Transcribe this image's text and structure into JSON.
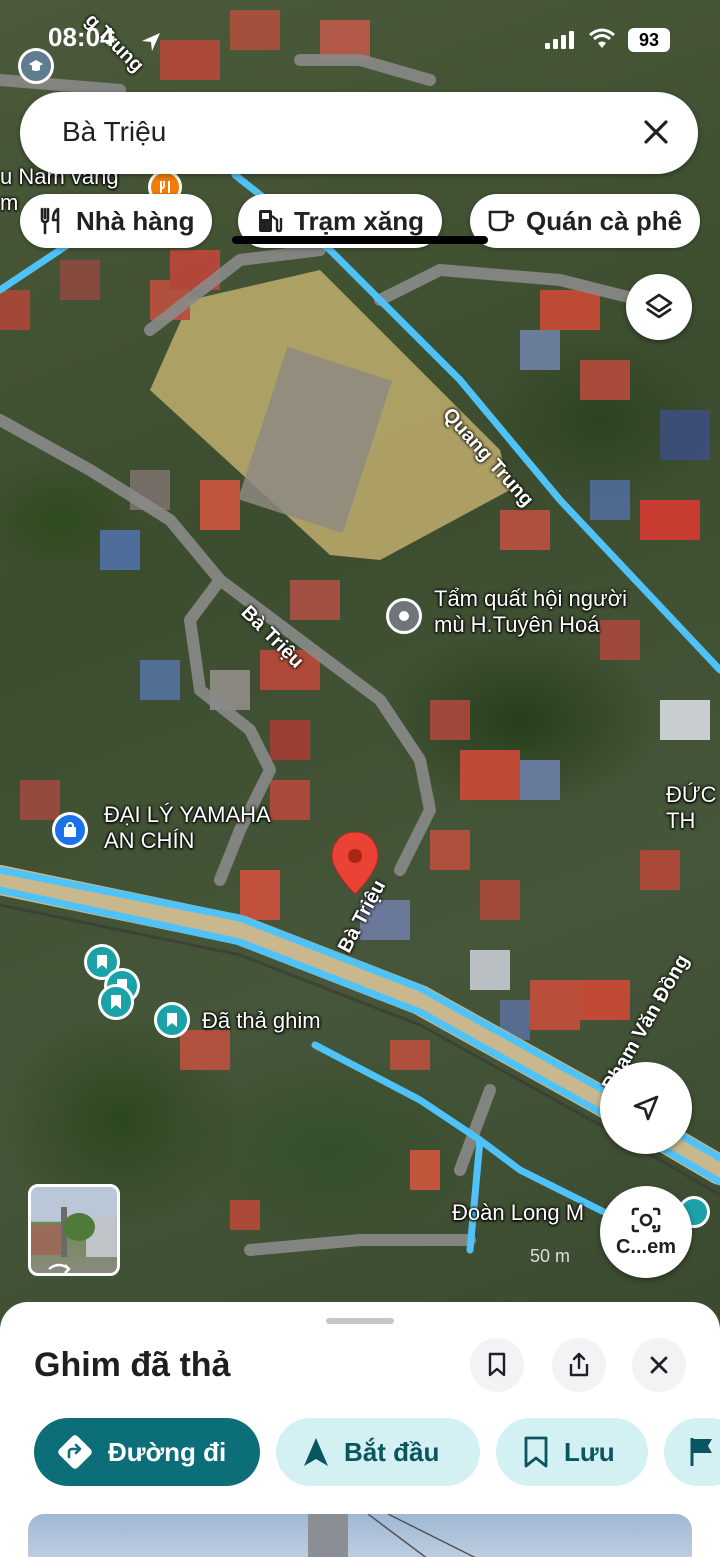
{
  "status_bar": {
    "time": "08:04",
    "battery": "93"
  },
  "search": {
    "query": "Bà Triệu"
  },
  "chips": [
    {
      "label": "Nhà hàng",
      "icon": "restaurant-icon"
    },
    {
      "label": "Trạm xăng",
      "icon": "gas-station-icon"
    },
    {
      "label": "Quán cà phê",
      "icon": "coffee-icon"
    }
  ],
  "map": {
    "place_labels": {
      "massage": "Tẩm quất hội người\nmù H.Tuyên Hoá",
      "yamaha": "ĐẠI LÝ YAMAHA\nAN CHÍN",
      "dropped_pin": "Đã thả ghim",
      "doan_long": "Đoàn Long M",
      "top_left": "u Nam vàng\nm",
      "duc_label": "ĐỨC\nTH"
    },
    "streets": {
      "quang_trung": "Quang Trung",
      "ba_trieu_upper": "Bà Triệu",
      "ba_trieu_lower": "Bà Triệu",
      "pham_van_dong": "Phạm Văn Đồng",
      "top_street": "g Trung"
    },
    "scale_text": "50 m"
  },
  "camera_button": {
    "label": "C...em"
  },
  "sheet": {
    "title": "Ghim đã thả",
    "actions": {
      "directions": "Đường đi",
      "start": "Bắt đầu",
      "save": "Lưu"
    }
  },
  "colors": {
    "route_blue": "#4fc3f7",
    "pin_red": "#ea4335",
    "teal": "#0b6e78",
    "teal_light": "#d3f0f3",
    "saved_pin": "#1ba1a8",
    "shop_pin": "#1a73e8"
  }
}
